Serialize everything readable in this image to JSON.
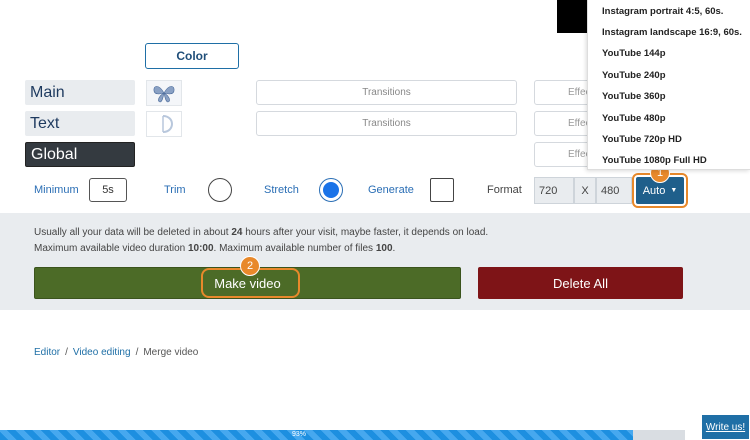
{
  "color_button": "Color",
  "layers": [
    {
      "label": "Main",
      "active": false,
      "transitions_placeholder": "Transitions",
      "effect_placeholder": "Effects"
    },
    {
      "label": "Text",
      "active": false,
      "transitions_placeholder": "Transitions",
      "effect_placeholder": "Effects"
    },
    {
      "label": "Global",
      "active": true,
      "effect_placeholder": "Effects"
    }
  ],
  "options": {
    "minimum_label": "Minimum",
    "minimum_value": "5s",
    "trim_label": "Trim",
    "trim_checked": false,
    "stretch_label": "Stretch",
    "stretch_checked": true,
    "generate_label": "Generate",
    "generate_checked": false,
    "format_label": "Format",
    "width": "720",
    "x_sep": "X",
    "height": "480",
    "auto_button": "Auto"
  },
  "format_menu": [
    "Instagram portrait 4:5, 60s.",
    "Instagram landscape 16:9, 60s.",
    "YouTube 144p",
    "YouTube 240p",
    "YouTube 360p",
    "YouTube 480p",
    "YouTube 720p HD",
    "YouTube 1080p Full HD"
  ],
  "info": {
    "line1_pre": "Usually all your data will be deleted in about ",
    "line1_bold": "24",
    "line1_post": " hours after your visit, maybe faster, it depends on load.",
    "line2_pre": "Maximum available video duration ",
    "line2_bold1": "10:00",
    "line2_mid": ". Maximum available number of files ",
    "line2_bold2": "100",
    "line2_post": "."
  },
  "make_video_button": "Make video",
  "delete_all_button": "Delete All",
  "step_badges": [
    "1",
    "2"
  ],
  "breadcrumb": [
    "Editor",
    "Video editing",
    "Merge video"
  ],
  "breadcrumb_sep": "/",
  "progress": {
    "value": 0.93,
    "label": "93%"
  },
  "write_us_button": "Write us!",
  "colors": {
    "accent": "#1f5f8b",
    "make_video": "#4c6b27",
    "delete": "#7e1417",
    "highlight": "#e8892b"
  }
}
